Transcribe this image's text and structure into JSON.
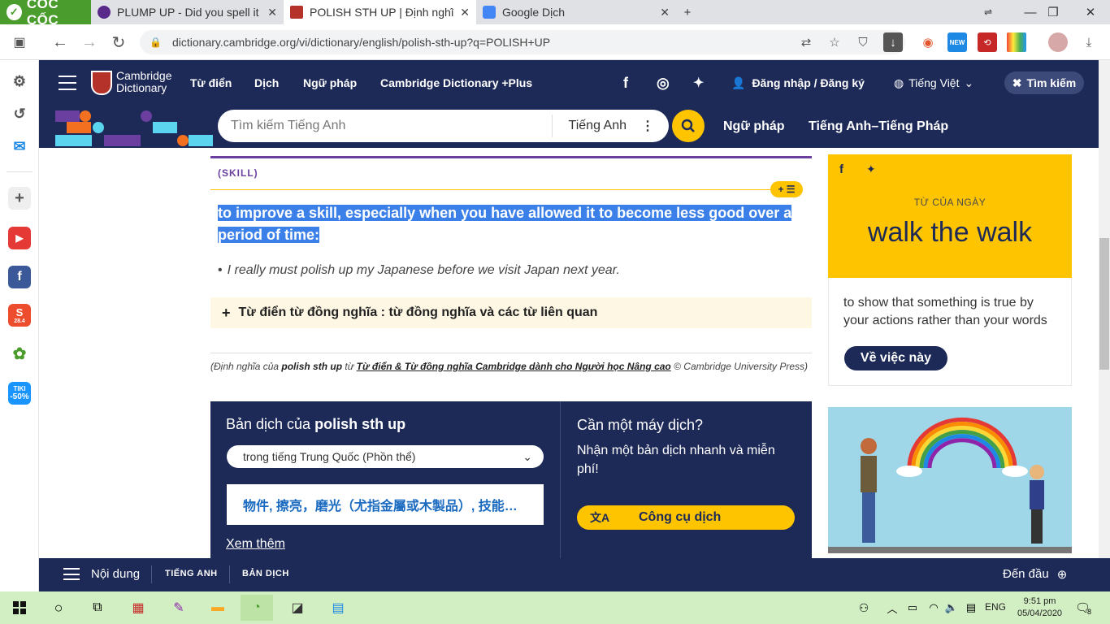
{
  "browser": {
    "brand": "CỐC CỐC",
    "tabs": [
      {
        "title": "PLUMP UP - Did you spell it c",
        "close": "✕"
      },
      {
        "title": "POLISH STH UP | Định nghĩa t",
        "close": "✕"
      },
      {
        "title": "Google Dịch",
        "close": "✕"
      }
    ],
    "new_tab": "+",
    "url": "dictionary.cambridge.org/vi/dictionary/english/polish-sth-up?q=POLISH+UP"
  },
  "header": {
    "logo_line1": "Cambridge",
    "logo_line2": "Dictionary",
    "nav": [
      "Từ điển",
      "Dịch",
      "Ngữ pháp",
      "Cambridge Dictionary +Plus"
    ],
    "login": "Đăng nhập / Đăng ký",
    "language": "Tiếng Việt",
    "search_toggle": "Tìm kiếm"
  },
  "search": {
    "placeholder": "Tìm kiếm Tiếng Anh",
    "dictionary": "Tiếng Anh",
    "links": [
      "Ngữ pháp",
      "Tiếng Anh–Tiếng Pháp"
    ]
  },
  "entry": {
    "label": "(SKILL)",
    "definition_1": "to improve a skill, especially when you have allowed it to become less good over a",
    "definition_2": "period of time:",
    "example": "I really must polish up my Japanese before we visit Japan next year.",
    "synonyms": "Từ điển từ đồng nghĩa : từ đồng nghĩa và các từ liên quan",
    "credit_prefix": "(Định nghĩa của ",
    "credit_term": "polish sth up",
    "credit_mid": " từ ",
    "credit_source": "Từ điển & Từ đồng nghĩa Cambridge dành cho Người học Nâng cao",
    "credit_suffix": " © Cambridge University Press)"
  },
  "translation": {
    "heading_prefix": "Bản dịch của ",
    "heading_term": "polish sth up",
    "language": "trong tiếng Trung Quốc (Phồn thể)",
    "result": "物件, 擦亮，磨光（尤指金屬或木製品）, 技能…",
    "more": "Xem thêm",
    "tool_heading": "Cần một máy dịch?",
    "tool_text_1": "Nhận một bản dịch nhanh và miễn",
    "tool_text_2": "phí!",
    "tool_button": "Công cụ dịch"
  },
  "word_of_day": {
    "label": "TỪ CỦA NGÀY",
    "word": "walk the walk",
    "definition_1": "to show that something is true by",
    "definition_2": "your actions rather than your words",
    "button": "Về việc này"
  },
  "bottom_bar": {
    "menu": "Nội dung",
    "tab1": "TIẾNG ANH",
    "tab2": "BẢN DỊCH",
    "top": "Đến đầu"
  },
  "taskbar": {
    "lang": "ENG",
    "time": "9:51 pm",
    "date": "05/04/2020",
    "notif": "8"
  },
  "sidebar_badges": {
    "shopee": "28.4",
    "tiki": "TIKI",
    "tiki_sale": "-50%"
  },
  "colors": {
    "navy": "#1d2a57",
    "yellow": "#fec400",
    "purple": "#6a3fa0",
    "browser_green": "#4a9d2c"
  }
}
